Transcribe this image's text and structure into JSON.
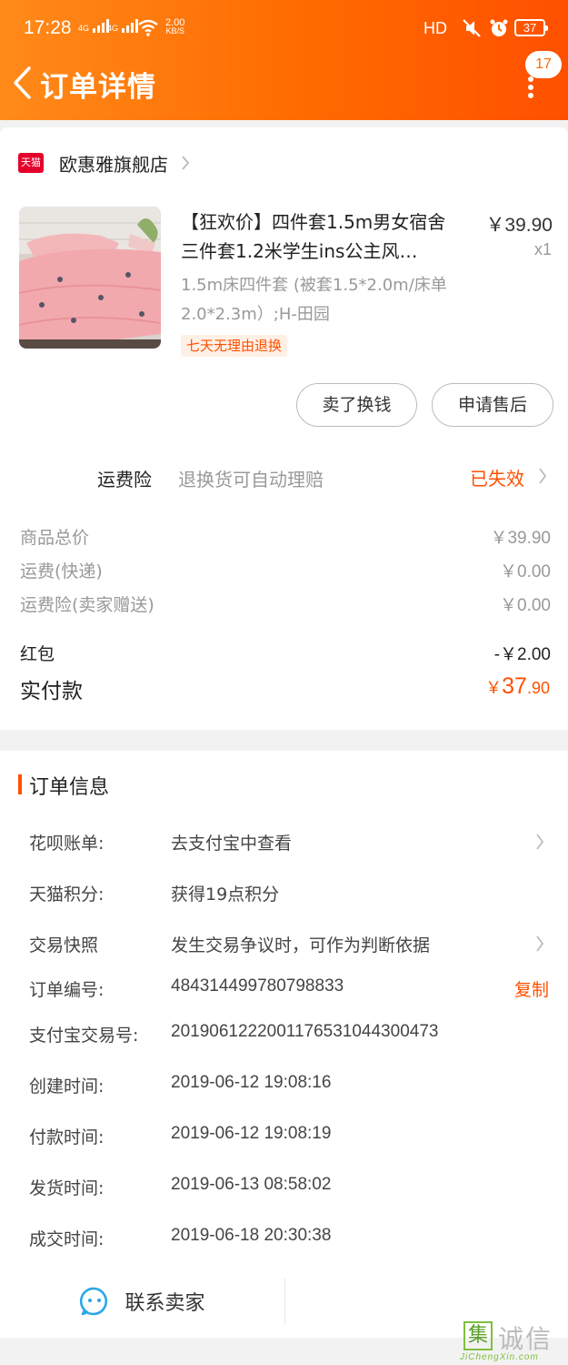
{
  "status_bar": {
    "time": "17:28",
    "net1": "4G",
    "net2": "4G",
    "speed_value": "2.00",
    "speed_unit": "KB/S",
    "hd": "HD",
    "battery": "37"
  },
  "header": {
    "title": "订单详情",
    "badge_count": "17",
    "accent_color": "#ff6a00"
  },
  "shop": {
    "logo_text": "天猫",
    "name": "欧惠雅旗舰店"
  },
  "product": {
    "title": "【狂欢价】四件套1.5m男女宿舍三件套1.2米学生ins公主风…",
    "price": "￥39.90",
    "qty": "x1",
    "sku": "1.5m床四件套 (被套1.5*2.0m/床单2.0*2.3m）;H-田园",
    "return_tag": "七天无理由退换"
  },
  "actions": {
    "sell_label": "卖了换钱",
    "after_sale_label": "申请售后"
  },
  "insurance": {
    "label": "运费险",
    "desc": "退换货可自动理赔",
    "status": "已失效"
  },
  "fees": [
    {
      "label": "商品总价",
      "value": "￥39.90"
    },
    {
      "label": "运费(快递)",
      "value": "￥0.00"
    },
    {
      "label": "运费险(卖家赠送)",
      "value": "￥0.00"
    },
    {
      "label": "红包",
      "value": "-￥2.00"
    }
  ],
  "paid": {
    "label": "实付款",
    "currency": "￥",
    "integer": "37",
    "decimal": ".90"
  },
  "order_info": {
    "section_title": "订单信息",
    "rows": [
      {
        "label": "花呗账单:",
        "value": "去支付宝中查看"
      },
      {
        "label": "天猫积分:",
        "value": "获得19点积分"
      },
      {
        "label": "交易快照",
        "value": "发生交易争议时，可作为判断依据"
      },
      {
        "label": "订单编号:",
        "value": "484314499780798833"
      },
      {
        "label": "支付宝交易号:",
        "value": "2019061222001176531044300473"
      },
      {
        "label": "创建时间:",
        "value": "2019-06-12 19:08:16"
      },
      {
        "label": "付款时间:",
        "value": "2019-06-12 19:08:19"
      },
      {
        "label": "发货时间:",
        "value": "2019-06-13 08:58:02"
      },
      {
        "label": "成交时间:",
        "value": "2019-06-18 20:30:38"
      }
    ],
    "copy_label": "复制"
  },
  "contact": {
    "label": "联系卖家"
  },
  "watermark": {
    "box_char": "集",
    "chars": "诚信",
    "sub": "JiChengXin.com"
  }
}
